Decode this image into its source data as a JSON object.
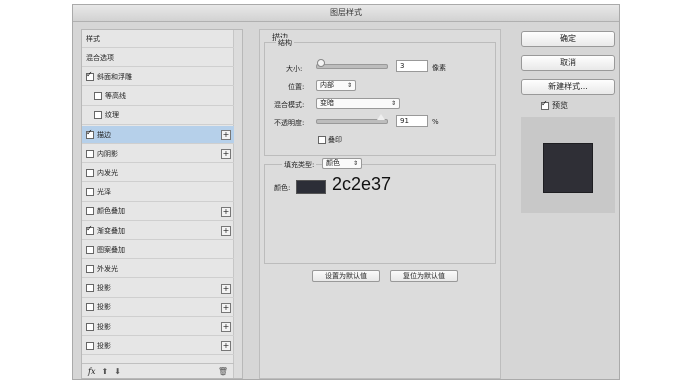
{
  "window": {
    "title": "图层样式"
  },
  "left": {
    "items": [
      {
        "label": "样式",
        "checkbox": false,
        "checked": false,
        "plus": false,
        "indent": false,
        "selected": false
      },
      {
        "label": "混合选项",
        "checkbox": false,
        "checked": false,
        "plus": false,
        "indent": false,
        "selected": false
      },
      {
        "label": "斜面和浮雕",
        "checkbox": true,
        "checked": true,
        "plus": false,
        "indent": false,
        "selected": false
      },
      {
        "label": "等高线",
        "checkbox": true,
        "checked": false,
        "plus": false,
        "indent": true,
        "selected": false
      },
      {
        "label": "纹理",
        "checkbox": true,
        "checked": false,
        "plus": false,
        "indent": true,
        "selected": false
      },
      {
        "label": "描边",
        "checkbox": true,
        "checked": true,
        "plus": true,
        "indent": false,
        "selected": true
      },
      {
        "label": "内阴影",
        "checkbox": true,
        "checked": false,
        "plus": true,
        "indent": false,
        "selected": false
      },
      {
        "label": "内发光",
        "checkbox": true,
        "checked": false,
        "plus": false,
        "indent": false,
        "selected": false
      },
      {
        "label": "光泽",
        "checkbox": true,
        "checked": false,
        "plus": false,
        "indent": false,
        "selected": false
      },
      {
        "label": "颜色叠加",
        "checkbox": true,
        "checked": false,
        "plus": true,
        "indent": false,
        "selected": false
      },
      {
        "label": "渐变叠加",
        "checkbox": true,
        "checked": true,
        "plus": true,
        "indent": false,
        "selected": false
      },
      {
        "label": "图案叠加",
        "checkbox": true,
        "checked": false,
        "plus": false,
        "indent": false,
        "selected": false
      },
      {
        "label": "外发光",
        "checkbox": true,
        "checked": false,
        "plus": false,
        "indent": false,
        "selected": false
      },
      {
        "label": "投影",
        "checkbox": true,
        "checked": false,
        "plus": true,
        "indent": false,
        "selected": false
      },
      {
        "label": "投影",
        "checkbox": true,
        "checked": false,
        "plus": true,
        "indent": false,
        "selected": false
      },
      {
        "label": "投影",
        "checkbox": true,
        "checked": false,
        "plus": true,
        "indent": false,
        "selected": false
      },
      {
        "label": "投影",
        "checkbox": true,
        "checked": false,
        "plus": true,
        "indent": false,
        "selected": false
      }
    ],
    "fx_label": "fx"
  },
  "stroke": {
    "section_title": "描边",
    "structure_title": "结构",
    "size_label": "大小:",
    "size_value": "3",
    "size_unit": "像素",
    "position_label": "位置:",
    "position_value": "内部",
    "blend_label": "混合模式:",
    "blend_value": "变暗",
    "opacity_label": "不透明度:",
    "opacity_value": "91",
    "opacity_unit": "%",
    "overprint_label": "叠印",
    "fill_type_label": "填充类型:",
    "fill_type_value": "颜色",
    "color_label": "颜色:",
    "color_swatch": "#2c2e37",
    "color_code": "2c2e37",
    "default_button": "设置为默认值",
    "reset_button": "复位为默认值"
  },
  "right": {
    "ok": "确定",
    "cancel": "取消",
    "new_style": "新建样式...",
    "preview_label": "预览",
    "preview_checked": true
  }
}
